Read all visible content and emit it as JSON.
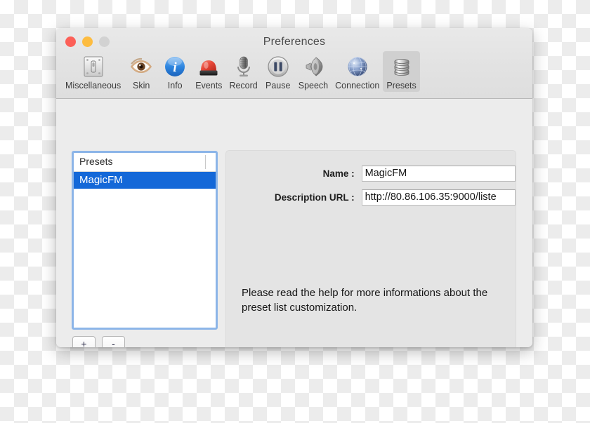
{
  "window": {
    "title": "Preferences",
    "traffic_lights": [
      {
        "name": "close",
        "color": "#fc6058"
      },
      {
        "name": "minimize",
        "color": "#fdbc40"
      },
      {
        "name": "zoom",
        "color": "#d2d2d2"
      }
    ]
  },
  "toolbar": {
    "items": [
      {
        "label": "Miscellaneous",
        "icon": "switch-plate-icon",
        "selected": false
      },
      {
        "label": "Skin",
        "icon": "eye-icon",
        "selected": false
      },
      {
        "label": "Info",
        "icon": "info-circle-icon",
        "selected": false
      },
      {
        "label": "Events",
        "icon": "siren-light-icon",
        "selected": false
      },
      {
        "label": "Record",
        "icon": "microphone-icon",
        "selected": false
      },
      {
        "label": "Pause",
        "icon": "pause-circle-icon",
        "selected": false
      },
      {
        "label": "Speech",
        "icon": "speaker-icon",
        "selected": false
      },
      {
        "label": "Connection",
        "icon": "globe-icon",
        "selected": false
      },
      {
        "label": "Presets",
        "icon": "database-stack-icon",
        "selected": true
      }
    ]
  },
  "presets_panel": {
    "list_header": "Presets",
    "rows": [
      {
        "label": "MagicFM",
        "selected": true
      }
    ],
    "add_button": "+",
    "remove_button": "-"
  },
  "detail_panel": {
    "name_label": "Name :",
    "name_value": "MagicFM",
    "url_label": "Description URL  :",
    "url_value": "http://80.86.106.35:9000/liste",
    "help_text": "Please read the help for more informations about the preset list customization."
  },
  "colors": {
    "selection_blue": "#1468d8",
    "focus_ring_blue": "#8cb5e8",
    "window_chrome": "#ececec",
    "detail_box": "#e4e4e4"
  }
}
